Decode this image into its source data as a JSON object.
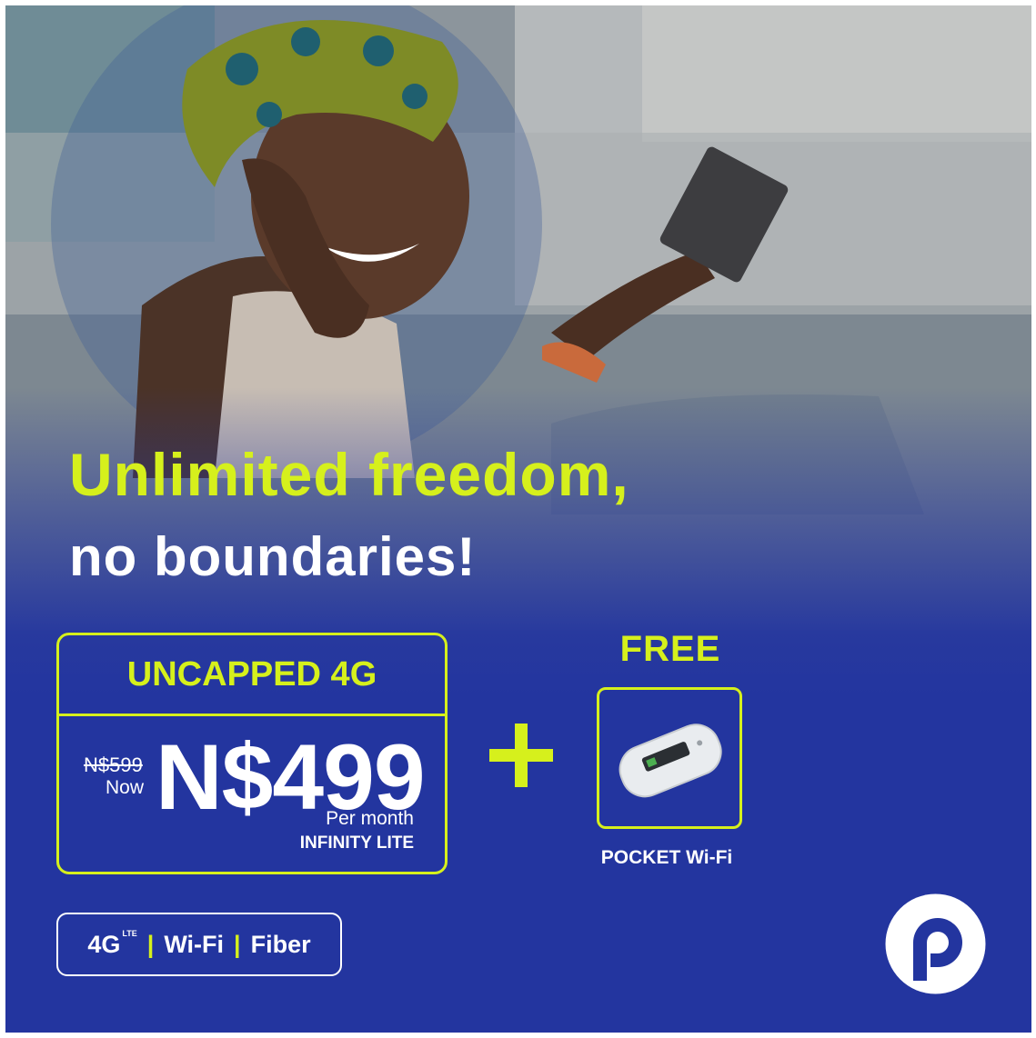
{
  "headline": {
    "line1": "Unlimited freedom,",
    "line2": "no boundaries!"
  },
  "offer": {
    "title": "UNCAPPED 4G",
    "old_price": "N$599",
    "now_label": "Now",
    "price": "N$499",
    "period": "Per month",
    "plan": "INFINITY LITE"
  },
  "plus_icon": "plus-icon",
  "bonus": {
    "free_label": "FREE",
    "device_icon": "pocket-wifi-router-image",
    "device_label": "POCKET Wi-Fi"
  },
  "technologies": {
    "items": [
      "4G",
      "Wi-Fi",
      "Fiber"
    ],
    "superscript": "LTE"
  },
  "brand": {
    "logo": "p-logo"
  },
  "colors": {
    "brand_blue": "#23359f",
    "accent_lime": "#d6f01c",
    "text_white": "#ffffff"
  }
}
